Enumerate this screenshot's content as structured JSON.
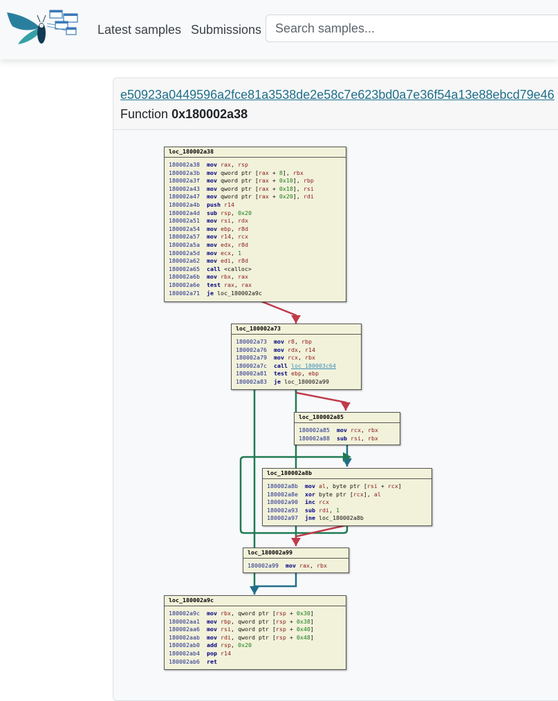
{
  "nav": {
    "latest": "Latest samples",
    "submissions": "Submissions",
    "search_placeholder": "Search samples..."
  },
  "sample": {
    "hash": "e50923a0449596a2fce81a3538de2e58c7e623bd0a7e36f54a13e88ebcd79e46",
    "function_label": "Function",
    "function_address": "0x180002a38"
  },
  "colors": {
    "edge_true": "#1f7a54",
    "edge_false": "#c03a4a",
    "edge_uncond": "#1f6e8a",
    "block_bg": "#f2f2da"
  },
  "blocks": [
    {
      "id": "b1",
      "title": "loc_180002a38",
      "lines": [
        [
          "180002a38",
          "mov",
          [
            [
              "rg",
              "rax"
            ],
            [
              "tx",
              ", "
            ],
            [
              "rg",
              "rsp"
            ]
          ]
        ],
        [
          "180002a3b",
          "mov",
          [
            [
              "tx",
              "qword ptr ["
            ],
            [
              "rg",
              "rax"
            ],
            [
              "tx",
              " + "
            ],
            [
              "im",
              "8"
            ],
            [
              "tx",
              "], "
            ],
            [
              "rg",
              "rbx"
            ]
          ]
        ],
        [
          "180002a3f",
          "mov",
          [
            [
              "tx",
              "qword ptr ["
            ],
            [
              "rg",
              "rax"
            ],
            [
              "tx",
              " + "
            ],
            [
              "im",
              "0x10"
            ],
            [
              "tx",
              "], "
            ],
            [
              "rg",
              "rbp"
            ]
          ]
        ],
        [
          "180002a43",
          "mov",
          [
            [
              "tx",
              "qword ptr ["
            ],
            [
              "rg",
              "rax"
            ],
            [
              "tx",
              " + "
            ],
            [
              "im",
              "0x18"
            ],
            [
              "tx",
              "], "
            ],
            [
              "rg",
              "rsi"
            ]
          ]
        ],
        [
          "180002a47",
          "mov",
          [
            [
              "tx",
              "qword ptr ["
            ],
            [
              "rg",
              "rax"
            ],
            [
              "tx",
              " + "
            ],
            [
              "im",
              "0x20"
            ],
            [
              "tx",
              "], "
            ],
            [
              "rg",
              "rdi"
            ]
          ]
        ],
        [
          "180002a4b",
          "push",
          [
            [
              "rg",
              "r14"
            ]
          ]
        ],
        [
          "180002a4d",
          "sub",
          [
            [
              "rg",
              "rsp"
            ],
            [
              "tx",
              ", "
            ],
            [
              "im",
              "0x20"
            ]
          ]
        ],
        [
          "180002a51",
          "mov",
          [
            [
              "rg",
              "rsi"
            ],
            [
              "tx",
              ", "
            ],
            [
              "rg",
              "rdx"
            ]
          ]
        ],
        [
          "180002a54",
          "mov",
          [
            [
              "rg",
              "ebp"
            ],
            [
              "tx",
              ", "
            ],
            [
              "rg",
              "r8d"
            ]
          ]
        ],
        [
          "180002a57",
          "mov",
          [
            [
              "rg",
              "r14"
            ],
            [
              "tx",
              ", "
            ],
            [
              "rg",
              "rcx"
            ]
          ]
        ],
        [
          "180002a5a",
          "mov",
          [
            [
              "rg",
              "edx"
            ],
            [
              "tx",
              ", "
            ],
            [
              "rg",
              "r8d"
            ]
          ]
        ],
        [
          "180002a5d",
          "mov",
          [
            [
              "rg",
              "ecx"
            ],
            [
              "tx",
              ", "
            ],
            [
              "im",
              "1"
            ]
          ]
        ],
        [
          "180002a62",
          "mov",
          [
            [
              "rg",
              "edi"
            ],
            [
              "tx",
              ", "
            ],
            [
              "rg",
              "r8d"
            ]
          ]
        ],
        [
          "180002a65",
          "call",
          [
            [
              "tx",
              "<calloc>"
            ]
          ]
        ],
        [
          "180002a6b",
          "mov",
          [
            [
              "rg",
              "rbx"
            ],
            [
              "tx",
              ", "
            ],
            [
              "rg",
              "rax"
            ]
          ]
        ],
        [
          "180002a6e",
          "test",
          [
            [
              "rg",
              "rax"
            ],
            [
              "tx",
              ", "
            ],
            [
              "rg",
              "rax"
            ]
          ]
        ],
        [
          "180002a71",
          "je",
          [
            [
              "tx",
              "loc_180002a9c"
            ]
          ]
        ]
      ]
    },
    {
      "id": "b2",
      "title": "loc_180002a73",
      "lines": [
        [
          "180002a73",
          "mov",
          [
            [
              "rg",
              "r8"
            ],
            [
              "tx",
              ", "
            ],
            [
              "rg",
              "rbp"
            ]
          ]
        ],
        [
          "180002a76",
          "mov",
          [
            [
              "rg",
              "rdx"
            ],
            [
              "tx",
              ", "
            ],
            [
              "rg",
              "r14"
            ]
          ]
        ],
        [
          "180002a79",
          "mov",
          [
            [
              "rg",
              "rcx"
            ],
            [
              "tx",
              ", "
            ],
            [
              "rg",
              "rbx"
            ]
          ]
        ],
        [
          "180002a7c",
          "call",
          [
            [
              "lk",
              "loc_180003c64"
            ]
          ]
        ],
        [
          "180002a81",
          "test",
          [
            [
              "rg",
              "ebp"
            ],
            [
              "tx",
              ", "
            ],
            [
              "rg",
              "ebp"
            ]
          ]
        ],
        [
          "180002a83",
          "je",
          [
            [
              "tx",
              "loc_180002a99"
            ]
          ]
        ]
      ]
    },
    {
      "id": "b3",
      "title": "loc_180002a85",
      "lines": [
        [
          "180002a85",
          "mov",
          [
            [
              "rg",
              "rcx"
            ],
            [
              "tx",
              ", "
            ],
            [
              "rg",
              "rbx"
            ]
          ]
        ],
        [
          "180002a88",
          "sub",
          [
            [
              "rg",
              "rsi"
            ],
            [
              "tx",
              ", "
            ],
            [
              "rg",
              "rbx"
            ]
          ]
        ]
      ]
    },
    {
      "id": "b4",
      "title": "loc_180002a8b",
      "lines": [
        [
          "180002a8b",
          "mov",
          [
            [
              "rg",
              "al"
            ],
            [
              "tx",
              ", byte ptr ["
            ],
            [
              "rg",
              "rsi"
            ],
            [
              "tx",
              " + "
            ],
            [
              "rg",
              "rcx"
            ],
            [
              "tx",
              "]"
            ]
          ]
        ],
        [
          "180002a8e",
          "xor",
          [
            [
              "tx",
              "byte ptr ["
            ],
            [
              "rg",
              "rcx"
            ],
            [
              "tx",
              "], "
            ],
            [
              "rg",
              "al"
            ]
          ]
        ],
        [
          "180002a90",
          "inc",
          [
            [
              "rg",
              "rcx"
            ]
          ]
        ],
        [
          "180002a93",
          "sub",
          [
            [
              "rg",
              "rdi"
            ],
            [
              "tx",
              ", "
            ],
            [
              "im",
              "1"
            ]
          ]
        ],
        [
          "180002a97",
          "jne",
          [
            [
              "tx",
              "loc_180002a8b"
            ]
          ]
        ]
      ]
    },
    {
      "id": "b5",
      "title": "loc_180002a99",
      "lines": [
        [
          "180002a99",
          "mov",
          [
            [
              "rg",
              "rax"
            ],
            [
              "tx",
              ", "
            ],
            [
              "rg",
              "rbx"
            ]
          ]
        ]
      ]
    },
    {
      "id": "b6",
      "title": "loc_180002a9c",
      "lines": [
        [
          "180002a9c",
          "mov",
          [
            [
              "rg",
              "rbx"
            ],
            [
              "tx",
              ", qword ptr ["
            ],
            [
              "rg",
              "rsp"
            ],
            [
              "tx",
              " + "
            ],
            [
              "im",
              "0x30"
            ],
            [
              "tx",
              "]"
            ]
          ]
        ],
        [
          "180002aa1",
          "mov",
          [
            [
              "rg",
              "rbp"
            ],
            [
              "tx",
              ", qword ptr ["
            ],
            [
              "rg",
              "rsp"
            ],
            [
              "tx",
              " + "
            ],
            [
              "im",
              "0x38"
            ],
            [
              "tx",
              "]"
            ]
          ]
        ],
        [
          "180002aa6",
          "mov",
          [
            [
              "rg",
              "rsi"
            ],
            [
              "tx",
              ", qword ptr ["
            ],
            [
              "rg",
              "rsp"
            ],
            [
              "tx",
              " + "
            ],
            [
              "im",
              "0x40"
            ],
            [
              "tx",
              "]"
            ]
          ]
        ],
        [
          "180002aab",
          "mov",
          [
            [
              "rg",
              "rdi"
            ],
            [
              "tx",
              ", qword ptr ["
            ],
            [
              "rg",
              "rsp"
            ],
            [
              "tx",
              " + "
            ],
            [
              "im",
              "0x48"
            ],
            [
              "tx",
              "]"
            ]
          ]
        ],
        [
          "180002ab0",
          "add",
          [
            [
              "rg",
              "rsp"
            ],
            [
              "tx",
              ", "
            ],
            [
              "im",
              "0x20"
            ]
          ]
        ],
        [
          "180002ab4",
          "pop",
          [
            [
              "rg",
              "r14"
            ]
          ]
        ],
        [
          "180002ab6",
          "ret",
          []
        ]
      ]
    }
  ]
}
